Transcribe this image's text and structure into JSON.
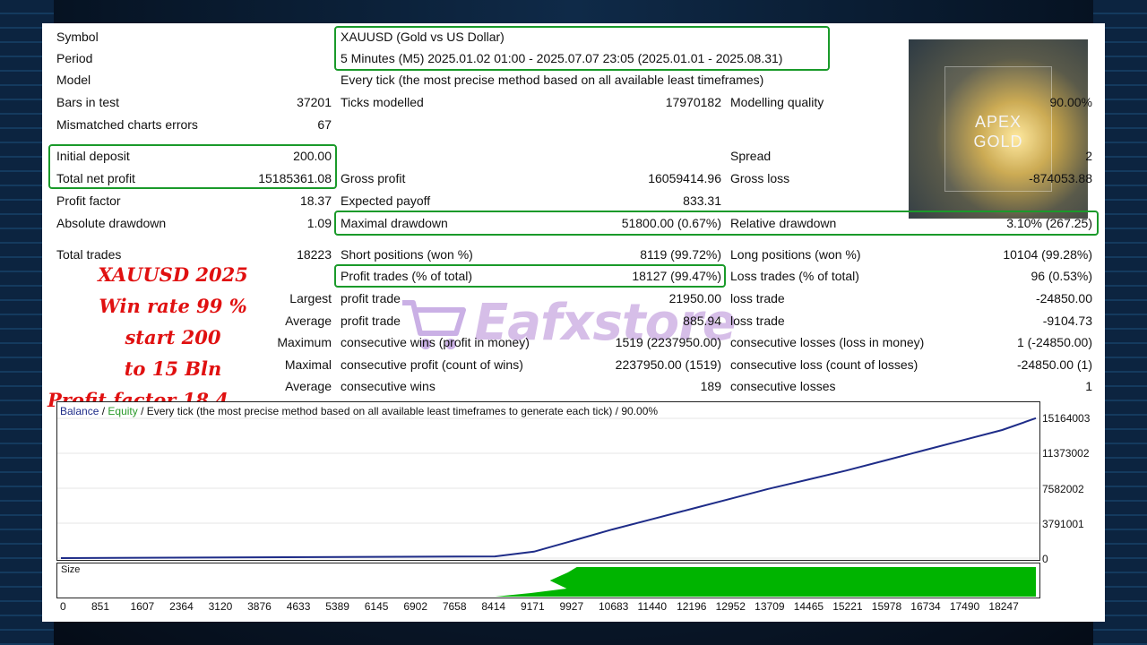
{
  "report": {
    "rows_top": [
      {
        "label": "Symbol",
        "value": "XAUUSD (Gold vs US Dollar)"
      },
      {
        "label": "Period",
        "value": "5 Minutes (M5) 2025.01.02 01:00 - 2025.07.07 23:05 (2025.01.01 - 2025.08.31)"
      },
      {
        "label": "Model",
        "value": "Every tick (the most precise method based on all available least timeframes)"
      }
    ],
    "bars_in_test": {
      "label": "Bars in test",
      "value": "37201"
    },
    "ticks_modelled": {
      "label": "Ticks modelled",
      "value": "17970182"
    },
    "modelling_quality": {
      "label": "Modelling quality",
      "value": "90.00%"
    },
    "mismatched": {
      "label": "Mismatched charts errors",
      "value": "67"
    },
    "initial_deposit": {
      "label": "Initial deposit",
      "value": "200.00"
    },
    "spread": {
      "label": "Spread",
      "value": "2"
    },
    "total_net_profit": {
      "label": "Total net profit",
      "value": "15185361.08"
    },
    "gross_profit": {
      "label": "Gross profit",
      "value": "16059414.96"
    },
    "gross_loss": {
      "label": "Gross loss",
      "value": "-874053.88"
    },
    "profit_factor": {
      "label": "Profit factor",
      "value": "18.37"
    },
    "expected_payoff": {
      "label": "Expected payoff",
      "value": "833.31"
    },
    "absolute_drawdown": {
      "label": "Absolute drawdown",
      "value": "1.09"
    },
    "maximal_drawdown": {
      "label": "Maximal drawdown",
      "value": "51800.00 (0.67%)"
    },
    "relative_drawdown": {
      "label": "Relative drawdown",
      "value": "3.10% (267.25)"
    },
    "total_trades": {
      "label": "Total trades",
      "value": "18223"
    },
    "short_positions": {
      "label": "Short positions (won %)",
      "value": "8119 (99.72%)"
    },
    "long_positions": {
      "label": "Long positions (won %)",
      "value": "10104 (99.28%)"
    },
    "profit_trades": {
      "label": "Profit trades (% of total)",
      "value": "18127 (99.47%)"
    },
    "loss_trades": {
      "label": "Loss trades (% of total)",
      "value": "96 (0.53%)"
    },
    "largest": {
      "prefix": "Largest",
      "profit_label": "profit trade",
      "profit_value": "21950.00",
      "loss_label": "loss trade",
      "loss_value": "-24850.00"
    },
    "average": {
      "prefix": "Average",
      "profit_label": "profit trade",
      "profit_value": "885.94",
      "loss_label": "loss trade",
      "loss_value": "-9104.73"
    },
    "maximum": {
      "prefix": "Maximum",
      "profit_label": "consecutive wins (profit in money)",
      "profit_value": "1519 (2237950.00)",
      "loss_label": "consecutive losses (loss in money)",
      "loss_value": "1 (-24850.00)"
    },
    "maximal": {
      "prefix": "Maximal",
      "profit_label": "consecutive profit (count of wins)",
      "profit_value": "2237950.00 (1519)",
      "loss_label": "consecutive loss (count of losses)",
      "loss_value": "-24850.00 (1)"
    },
    "average2": {
      "prefix": "Average",
      "profit_label": "consecutive wins",
      "profit_value": "189",
      "loss_label": "consecutive losses",
      "loss_value": "1"
    }
  },
  "promo": {
    "lines": [
      "XAUUSD 2025",
      "Win rate 99 %",
      "start 200",
      "to 15 Bln",
      "Profit factor 18.4"
    ],
    "apex_line1": "APEX",
    "apex_line2": "GOLD",
    "watermark": "Eafxstore"
  },
  "chart_legend": {
    "balance": "Balance",
    "sep1": " / ",
    "equity": "Equity",
    "rest": " / Every tick (the most precise method based on all available least timeframes to generate each tick) / 90.00%"
  },
  "size_label": "Size",
  "colors": {
    "highlight": "#1a9a2a",
    "balance_line": "#1e2c88",
    "size_bars": "#00b400",
    "promo_text": "#e01010"
  },
  "chart_data": {
    "type": "line",
    "x": [
      0,
      851,
      1607,
      2364,
      3120,
      3876,
      4633,
      5389,
      6145,
      6902,
      7658,
      8414,
      9171,
      9927,
      10683,
      11440,
      12196,
      12952,
      13709,
      14465,
      15221,
      15978,
      16734,
      17490,
      18247
    ],
    "x_tick_labels": [
      "0",
      "851",
      "1607",
      "2364",
      "3120",
      "3876",
      "4633",
      "5389",
      "6145",
      "6902",
      "7658",
      "8414",
      "9171",
      "9927",
      "10683",
      "11440",
      "12196",
      "12952",
      "13709",
      "14465",
      "15221",
      "15978",
      "16734",
      "17490",
      "18247"
    ],
    "y_tick_labels": [
      "15164003",
      "11373002",
      "7582002",
      "3791001",
      "0"
    ],
    "y_ticks": [
      15164003,
      11373002,
      7582002,
      3791001,
      0
    ],
    "ylim": [
      0,
      15164003
    ],
    "xlim": [
      0,
      18247
    ],
    "series": [
      {
        "name": "Balance",
        "x": [
          0,
          8414,
          9171,
          9927,
          10683,
          11440,
          12196,
          12952,
          13709,
          14465,
          15221,
          15978,
          16734,
          17490,
          18247,
          18900
        ],
        "values": [
          200,
          180000,
          700000,
          1900000,
          3100000,
          4200000,
          5300000,
          6400000,
          7500000,
          8500000,
          9500000,
          10600000,
          11700000,
          12800000,
          13900000,
          15185361
        ]
      }
    ],
    "size_bars": {
      "x_start": 8414,
      "x_ramp_end": 10000,
      "x_end": 18900,
      "level": 1.0
    }
  }
}
